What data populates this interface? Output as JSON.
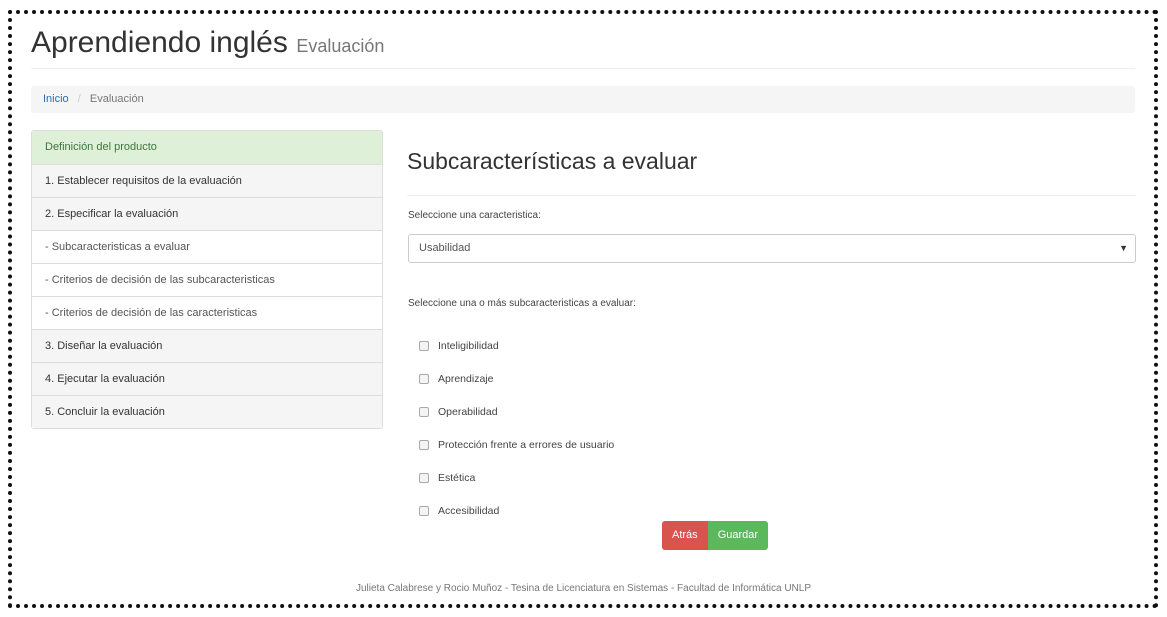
{
  "header": {
    "title": "Aprendiendo inglés",
    "subtitle": "Evaluación"
  },
  "breadcrumb": {
    "home": "Inicio",
    "separator": "/",
    "current": "Evaluación"
  },
  "sidebar": {
    "items": [
      {
        "label": "Definición del producto",
        "state": "active"
      },
      {
        "label": "1. Establecer requisitos de la evaluación",
        "state": "normal"
      },
      {
        "label": "2. Especificar la evaluación",
        "state": "normal"
      },
      {
        "label": "- Subcaracteristicas a evaluar",
        "state": "sub"
      },
      {
        "label": "- Criterios de decisión de las subcaracteristicas",
        "state": "sub"
      },
      {
        "label": "- Criterios de decisión de las caracteristicas",
        "state": "sub"
      },
      {
        "label": "3. Diseñar la evaluación",
        "state": "normal"
      },
      {
        "label": "4. Ejecutar la evaluación",
        "state": "normal"
      },
      {
        "label": "5. Concluir la evaluación",
        "state": "normal"
      }
    ]
  },
  "main": {
    "heading": "Subcaracterísticas a evaluar",
    "select_label": "Seleccione una caracteristica:",
    "select_value": "Usabilidad",
    "select_arrow": "▼",
    "checks_label": "Seleccione una o más subcaracteristicas a evaluar:",
    "checkboxes": [
      {
        "label": "Inteligibilidad",
        "checked": false
      },
      {
        "label": "Aprendizaje",
        "checked": false
      },
      {
        "label": "Operabilidad",
        "checked": false
      },
      {
        "label": "Protección frente a errores de usuario",
        "checked": false
      },
      {
        "label": "Estética",
        "checked": false
      },
      {
        "label": "Accesibilidad",
        "checked": false
      }
    ],
    "back_label": "Atrás",
    "save_label": "Guardar"
  },
  "footer": {
    "text": "Julieta Calabrese y Rocio Muñoz - Tesina de Licenciatura en Sistemas - Facultad de Informática UNLP"
  },
  "colors": {
    "active_bg": "#dff0d8",
    "active_text": "#3c763d",
    "link": "#2a6fb5",
    "danger": "#d9534f",
    "success": "#5cb85c"
  }
}
